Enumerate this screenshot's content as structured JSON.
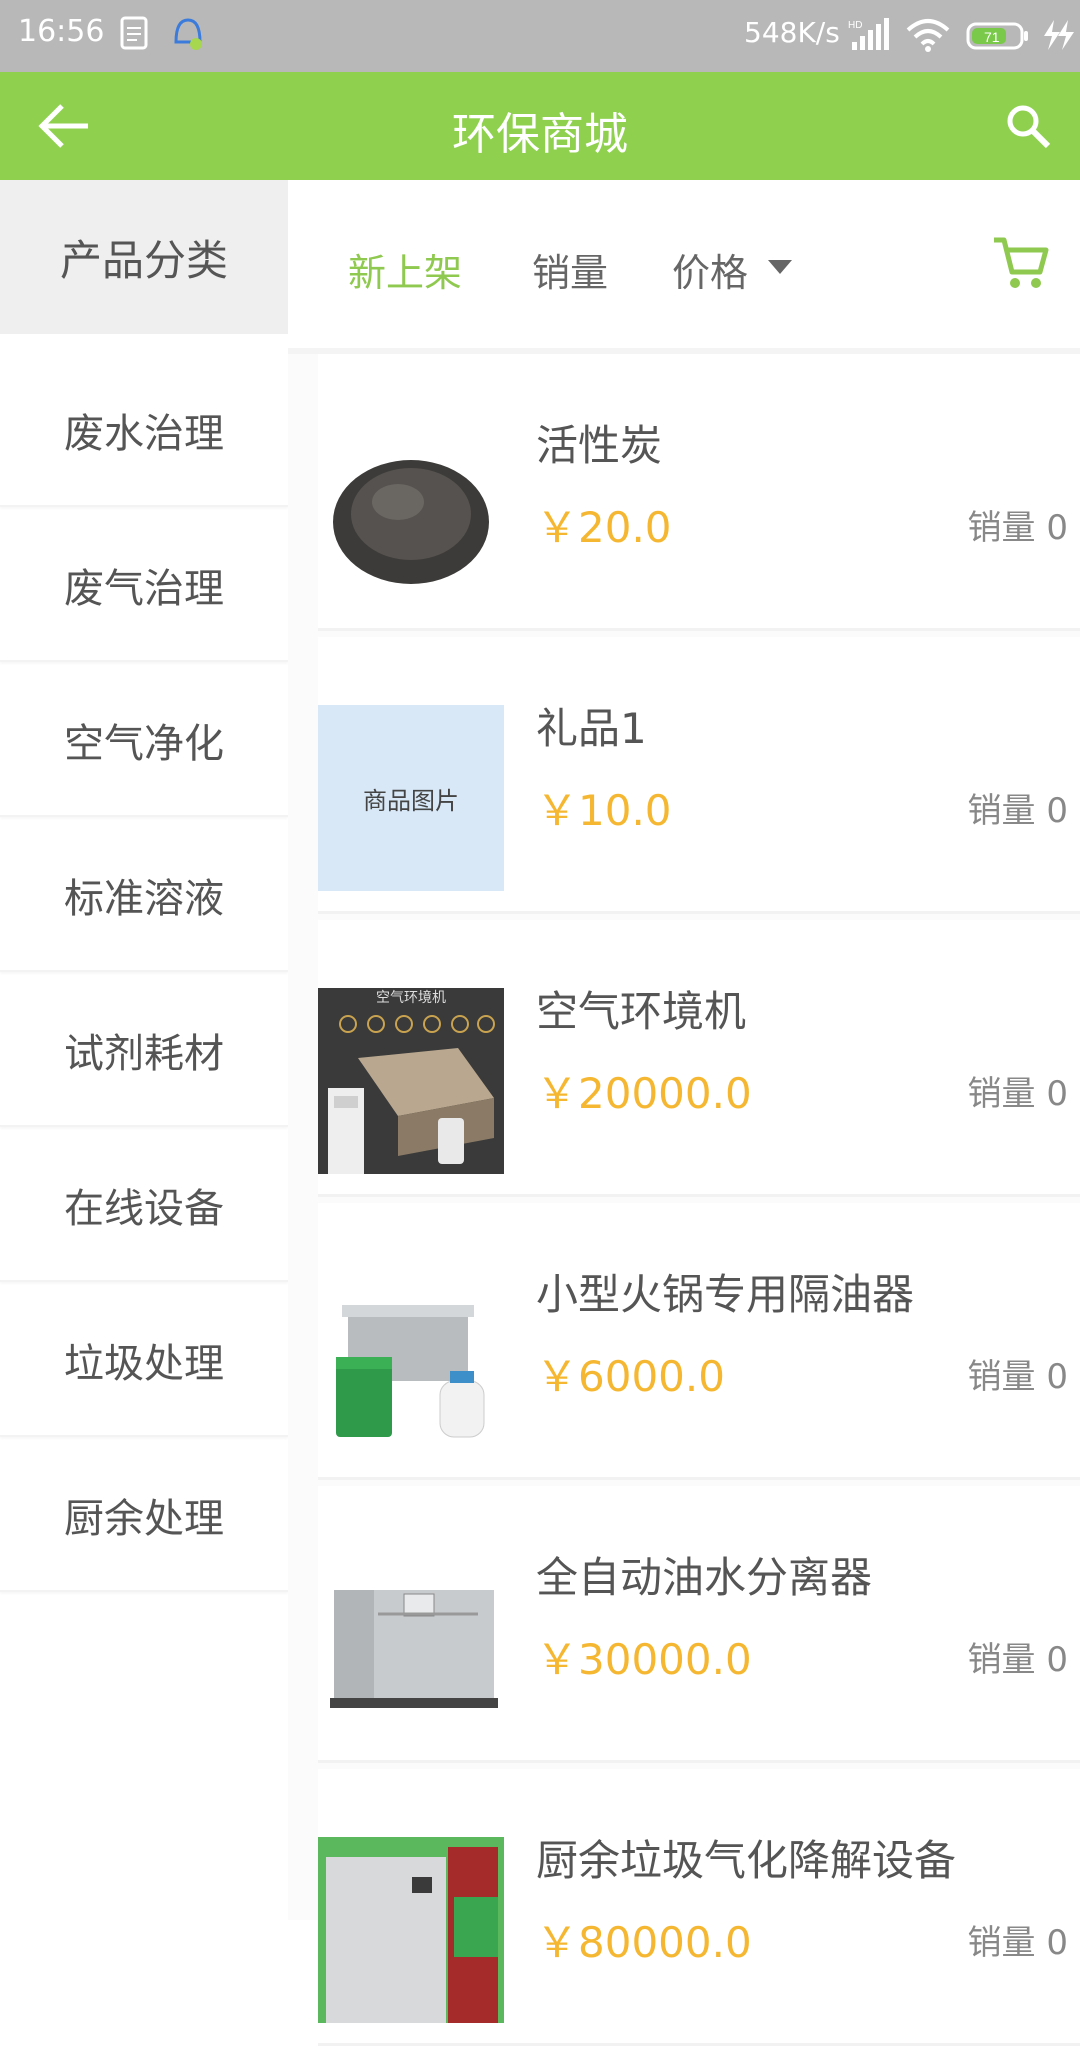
{
  "status_bar": {
    "time": "16:56",
    "net_speed": "548K/s",
    "battery": "71"
  },
  "app_bar": {
    "title": "环保商城"
  },
  "sidebar": {
    "header": "产品分类",
    "items": [
      {
        "label": "废水治理"
      },
      {
        "label": "废气治理"
      },
      {
        "label": "空气净化"
      },
      {
        "label": "标准溶液"
      },
      {
        "label": "试剂耗材"
      },
      {
        "label": "在线设备"
      },
      {
        "label": "垃圾处理"
      },
      {
        "label": "厨余处理"
      }
    ]
  },
  "sort_bar": {
    "new_label": "新上架",
    "sales_label": "销量",
    "price_label": "价格"
  },
  "products": [
    {
      "name": "活性炭",
      "price": "￥20.0",
      "sales": "销量 0"
    },
    {
      "name": "礼品1",
      "price": "￥10.0",
      "sales": "销量 0",
      "image_text": "商品图片"
    },
    {
      "name": "空气环境机",
      "price": "￥20000.0",
      "sales": "销量 0",
      "image_text": "空气环境机"
    },
    {
      "name": "小型火锅专用隔油器",
      "price": "￥6000.0",
      "sales": "销量 0"
    },
    {
      "name": "全自动油水分离器",
      "price": "￥30000.0",
      "sales": "销量 0"
    },
    {
      "name": "厨余垃圾气化降解设备",
      "price": "￥80000.0",
      "sales": "销量 0"
    }
  ],
  "colors": {
    "primary": "#8fd14f",
    "price": "#f5b731",
    "status_bar": "#b8b8b8"
  }
}
